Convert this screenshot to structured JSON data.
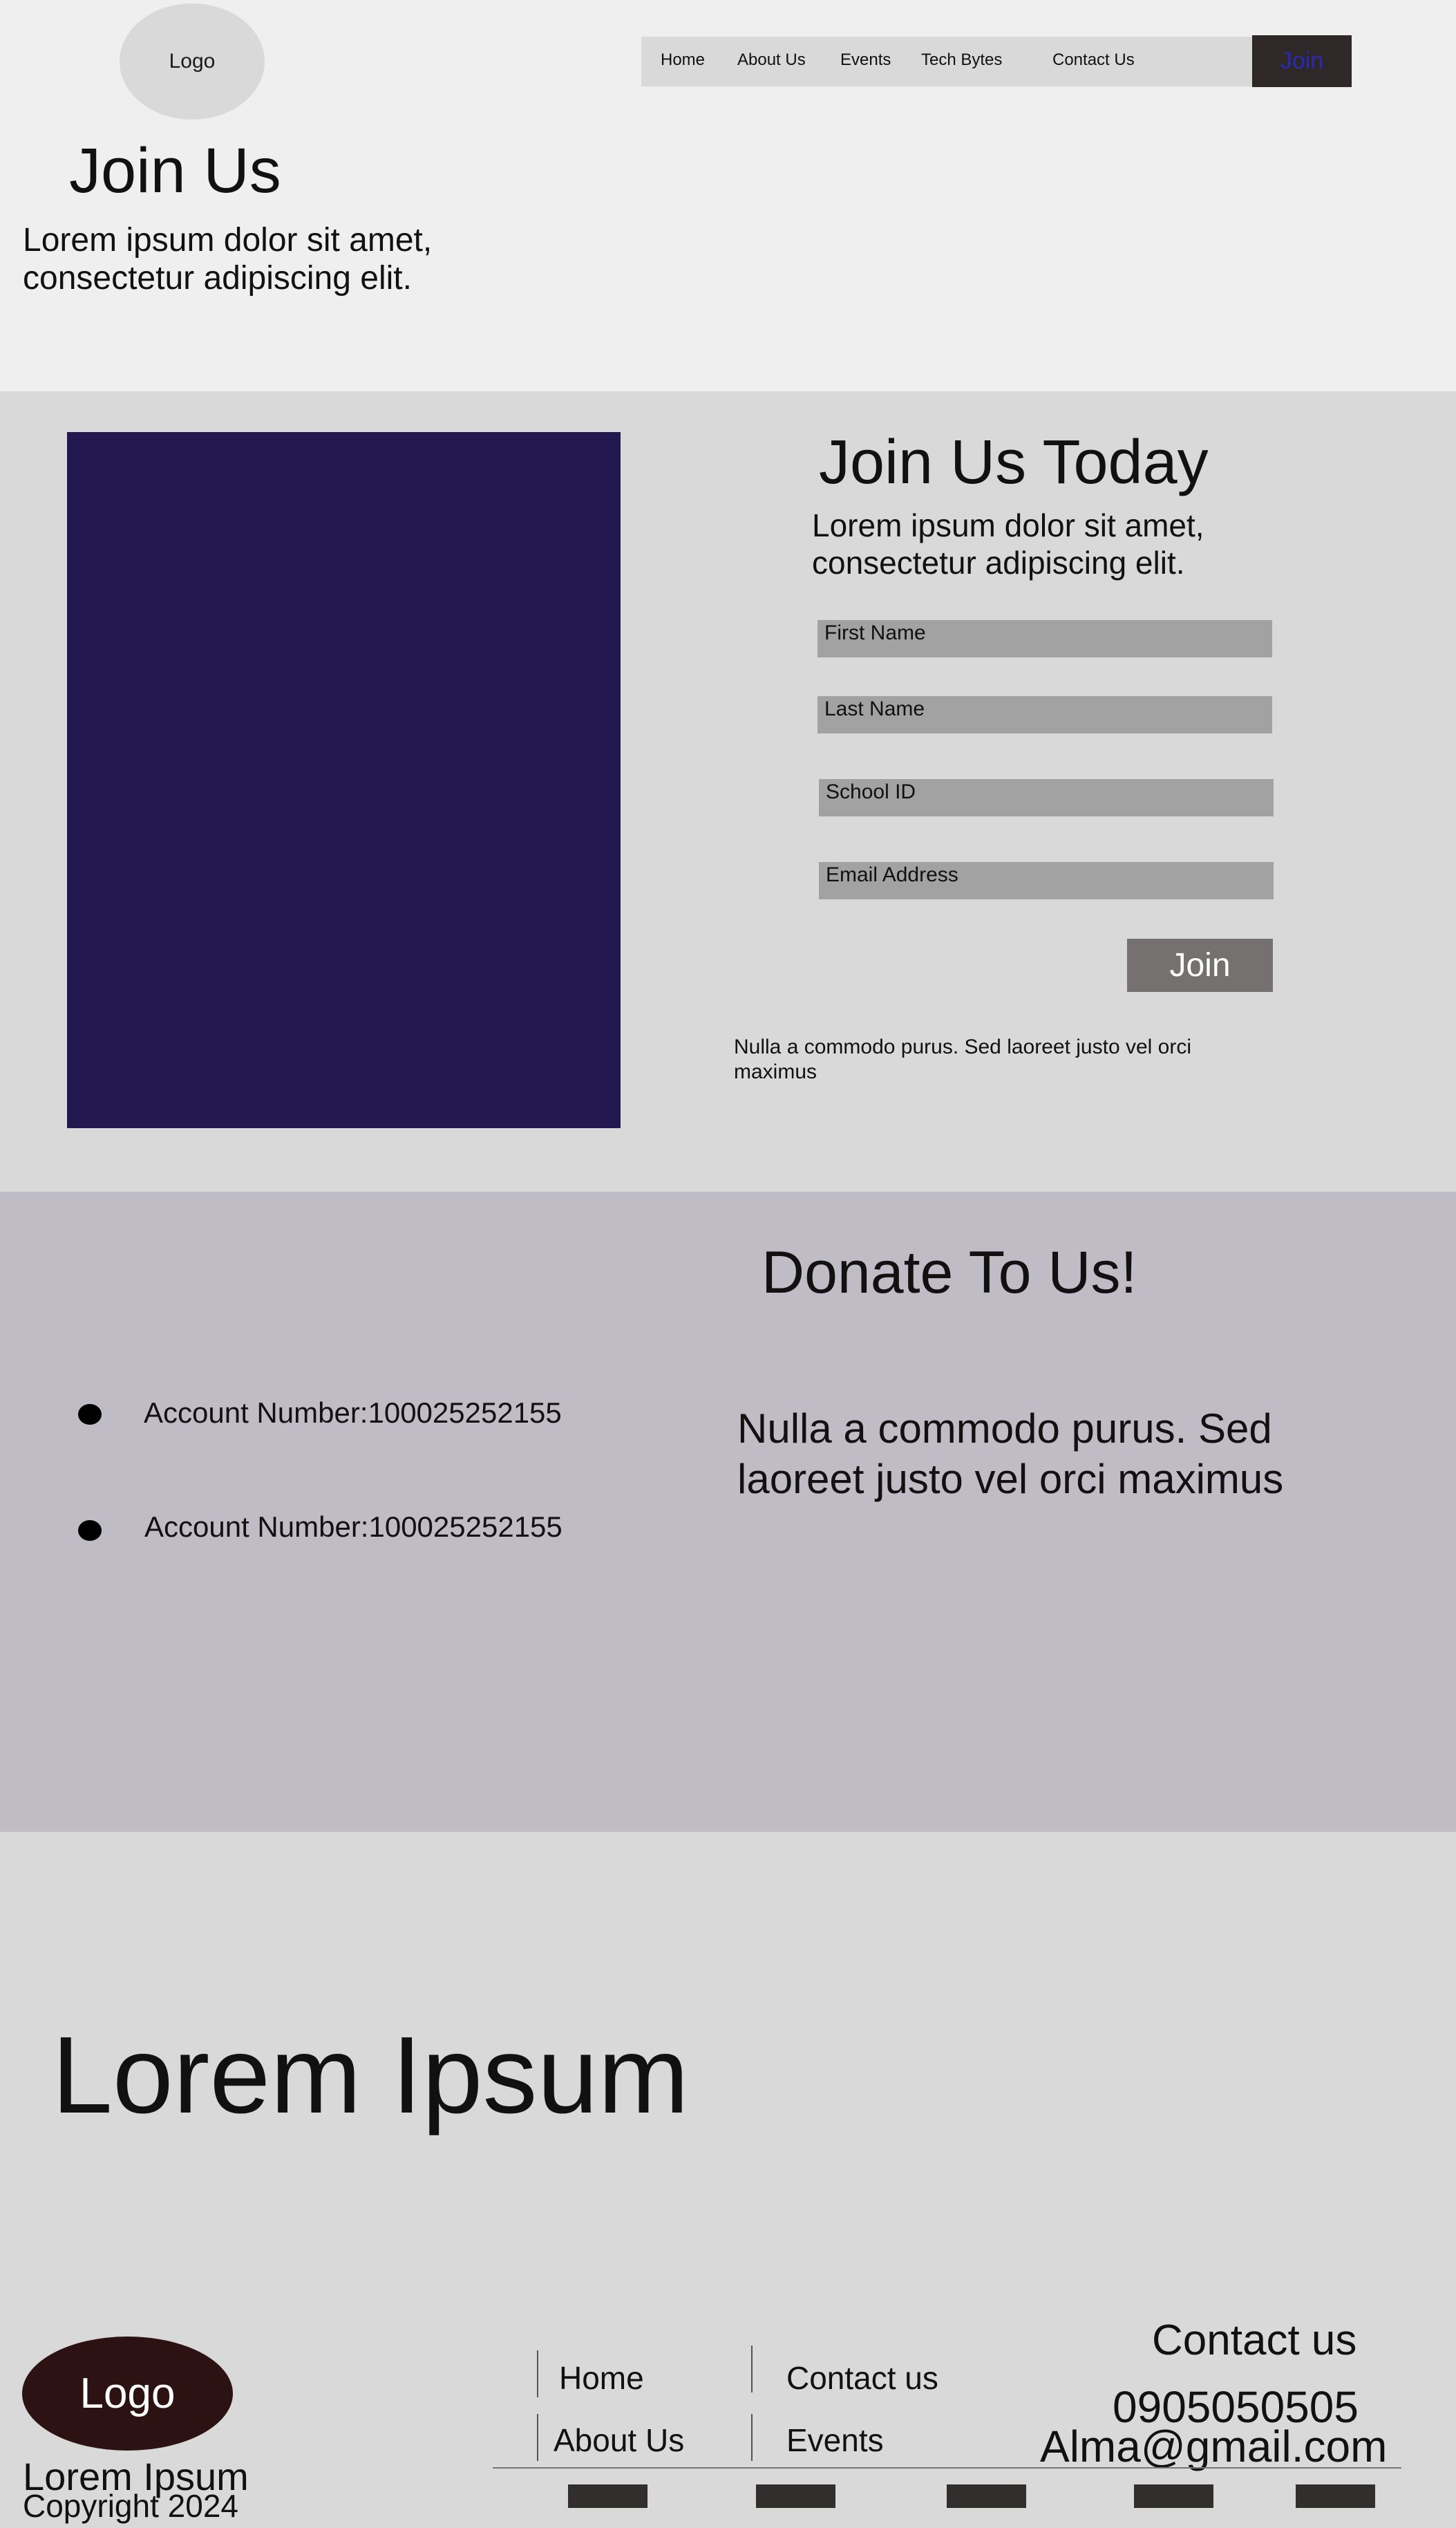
{
  "header": {
    "logo": "Logo",
    "nav": [
      {
        "label": "Home"
      },
      {
        "label": "About Us"
      },
      {
        "label": "Events"
      },
      {
        "label": "Tech Bytes"
      },
      {
        "label": "Contact Us"
      }
    ],
    "join_label": "Join",
    "title": "Join Us",
    "subtitle": "Lorem ipsum dolor sit amet, consectetur adipiscing elit."
  },
  "join_form": {
    "title": "Join Us Today",
    "subtitle": "Lorem ipsum dolor sit amet, consectetur adipiscing elit.",
    "fields": [
      {
        "label": "First Name"
      },
      {
        "label": "Last Name"
      },
      {
        "label": "School ID"
      },
      {
        "label": "Email Address"
      }
    ],
    "submit_label": "Join",
    "note": "Nulla a commodo purus. Sed laoreet justo vel orci maximus"
  },
  "donate": {
    "title": "Donate To Us!",
    "accounts": [
      {
        "label": "Account Number:100025252155"
      },
      {
        "label": "Account Number:100025252155"
      }
    ],
    "text": "Nulla a commodo purus. Sed laoreet justo vel orci maximus"
  },
  "footer": {
    "title": "Lorem Ipsum",
    "logo": "Logo",
    "brand": "Lorem Ipsum",
    "copyright": "Copyright 2024",
    "links": [
      {
        "label": "Home"
      },
      {
        "label": "About Us"
      },
      {
        "label": "Contact us"
      },
      {
        "label": "Events"
      }
    ],
    "contact_title": "Contact us",
    "phone": "0905050505",
    "email": "Alma@gmail.com"
  },
  "colors": {
    "hero_bg": "#efefef",
    "section_bg": "#d9d9d9",
    "image_placeholder": "#241850",
    "donate_bg": "#bfbcc6",
    "footer_logo_bg": "#2d1214",
    "nav_join_bg": "#2e2828",
    "nav_join_text": "#2a2ab0"
  }
}
